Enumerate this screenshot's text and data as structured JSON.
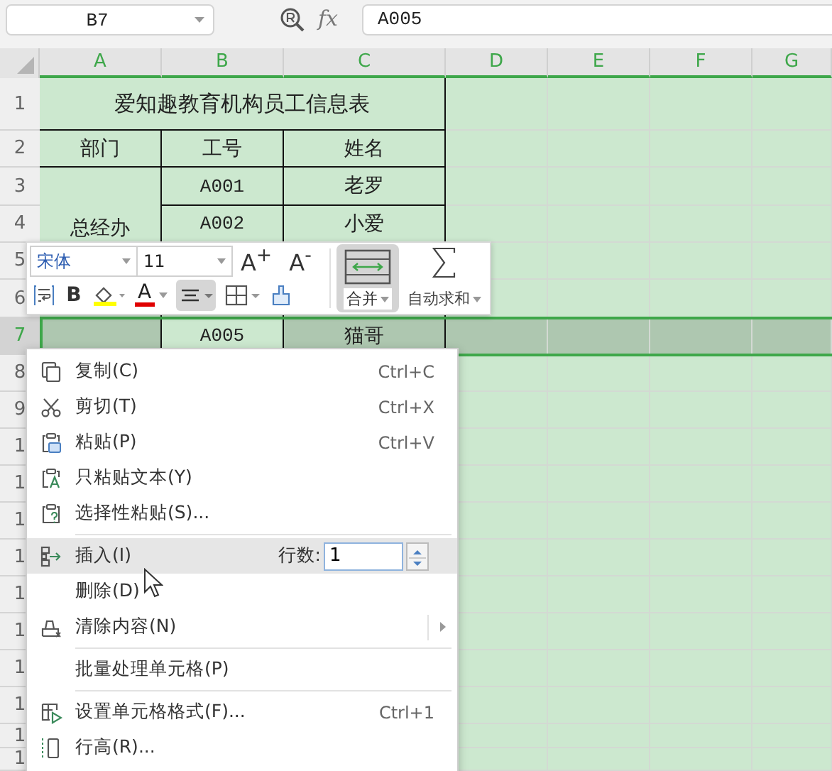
{
  "name_box": {
    "value": "B7"
  },
  "formula_bar": {
    "fx_label": "fx",
    "value": "A005"
  },
  "columns": [
    {
      "label": "A",
      "selected": true
    },
    {
      "label": "B",
      "selected": true
    },
    {
      "label": "C",
      "selected": true
    },
    {
      "label": "D",
      "selected": true
    },
    {
      "label": "E",
      "selected": true
    },
    {
      "label": "F",
      "selected": true
    },
    {
      "label": "G",
      "selected": true
    }
  ],
  "rows": [
    {
      "label": "1",
      "selected": false
    },
    {
      "label": "2",
      "selected": false
    },
    {
      "label": "3",
      "selected": false
    },
    {
      "label": "4",
      "selected": false
    },
    {
      "label": "5",
      "selected": false
    },
    {
      "label": "6",
      "selected": false
    },
    {
      "label": "7",
      "selected": true
    },
    {
      "label": "8",
      "selected": false
    },
    {
      "label": "9",
      "selected": false
    },
    {
      "label": "1",
      "selected": false
    },
    {
      "label": "1",
      "selected": false
    },
    {
      "label": "1",
      "selected": false
    },
    {
      "label": "1",
      "selected": false
    },
    {
      "label": "1",
      "selected": false
    },
    {
      "label": "1",
      "selected": false
    },
    {
      "label": "1",
      "selected": false
    },
    {
      "label": "1",
      "selected": false
    },
    {
      "label": "1",
      "selected": false
    },
    {
      "label": "1",
      "selected": false
    }
  ],
  "table": {
    "title": "爱知趣教育机构员工信息表",
    "headers": [
      "部门",
      "工号",
      "姓名"
    ],
    "department": "总经办",
    "records": [
      {
        "kind": "record",
        "id": "A001",
        "name": "老罗",
        "active": false
      },
      {
        "kind": "record",
        "id": "A002",
        "name": "小爱",
        "active": false
      },
      {
        "kind": "covered"
      },
      {
        "kind": "covered"
      },
      {
        "kind": "record",
        "id": "A005",
        "name": "猫哥",
        "active": true
      }
    ]
  },
  "mini_toolbar": {
    "font": "宋体",
    "size": "11",
    "grow_label": "A$^{+}$",
    "shrink_label": "A$^{-}$",
    "bold_label": "B",
    "font_color_label": "A",
    "align_selected": true,
    "merge": {
      "label": "合并",
      "selected": true
    },
    "autosum_label": "自动求和"
  },
  "menu": {
    "items": [
      {
        "kind": "item",
        "label": "复制(C)",
        "shortcut": "Ctrl+C",
        "selected": false,
        "has_submenu": false
      },
      {
        "kind": "item",
        "label": "剪切(T)",
        "shortcut": "Ctrl+X",
        "selected": false,
        "has_submenu": false
      },
      {
        "kind": "item",
        "label": "粘贴(P)",
        "shortcut": "Ctrl+V",
        "selected": false,
        "has_submenu": false
      },
      {
        "kind": "item",
        "label": "只粘贴文本(Y)",
        "selected": false,
        "has_submenu": false
      },
      {
        "kind": "item",
        "label": "选择性粘贴(S)...",
        "selected": false,
        "has_submenu": false
      },
      {
        "kind": "separator"
      },
      {
        "kind": "item",
        "label": "插入(I)",
        "selected": true,
        "has_submenu": false,
        "field": {
          "label": "行数:",
          "value": "1"
        }
      },
      {
        "kind": "item",
        "label": "删除(D)",
        "selected": false,
        "has_submenu": false
      },
      {
        "kind": "item",
        "label": "清除内容(N)",
        "selected": false,
        "has_submenu": true
      },
      {
        "kind": "separator"
      },
      {
        "kind": "item",
        "label": "批量处理单元格(P)",
        "selected": false,
        "has_submenu": false
      },
      {
        "kind": "separator"
      },
      {
        "kind": "item",
        "label": "设置单元格格式(F)...",
        "shortcut": "Ctrl+1",
        "selected": false,
        "has_submenu": false
      },
      {
        "kind": "item",
        "label": "行高(R)...",
        "selected": false,
        "has_submenu": false
      }
    ]
  }
}
